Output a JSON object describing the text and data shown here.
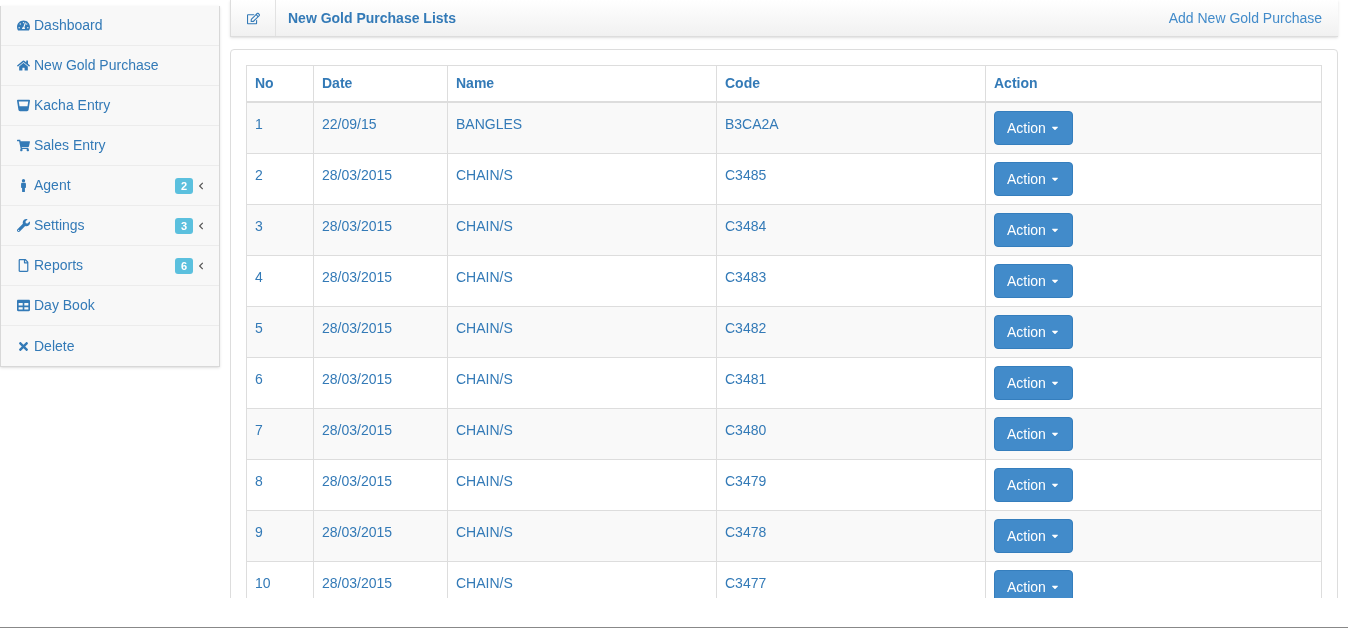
{
  "sidebar": {
    "items": [
      {
        "label": "Dashboard",
        "selected": false
      },
      {
        "label": "New Gold Purchase",
        "selected": false
      },
      {
        "label": "Kacha Entry",
        "selected": false
      },
      {
        "label": "Sales Entry",
        "selected": false
      },
      {
        "label": "Agent",
        "selected": false,
        "badge": "2",
        "submenu": true
      },
      {
        "label": "Settings",
        "selected": false,
        "badge": "3",
        "submenu": true
      },
      {
        "label": "Reports",
        "selected": false,
        "badge": "6",
        "submenu": true
      },
      {
        "label": "Day Book",
        "selected": false
      },
      {
        "label": "Delete",
        "selected": false
      }
    ]
  },
  "header": {
    "title": "New Gold Purchase Lists",
    "link": "Add New Gold Purchase"
  },
  "table": {
    "columns": [
      "No",
      "Date",
      "Name",
      "Code",
      "Action"
    ],
    "rows": [
      {
        "no": "1",
        "date": "22/09/15",
        "name": "BANGLES",
        "code": "B3CA2A",
        "action": "Action"
      },
      {
        "no": "2",
        "date": "28/03/2015",
        "name": "CHAIN/S",
        "code": "C3485",
        "action": "Action"
      },
      {
        "no": "3",
        "date": "28/03/2015",
        "name": "CHAIN/S",
        "code": "C3484",
        "action": "Action"
      },
      {
        "no": "4",
        "date": "28/03/2015",
        "name": "CHAIN/S",
        "code": "C3483",
        "action": "Action"
      },
      {
        "no": "5",
        "date": "28/03/2015",
        "name": "CHAIN/S",
        "code": "C3482",
        "action": "Action"
      },
      {
        "no": "6",
        "date": "28/03/2015",
        "name": "CHAIN/S",
        "code": "C3481",
        "action": "Action"
      },
      {
        "no": "7",
        "date": "28/03/2015",
        "name": "CHAIN/S",
        "code": "C3480",
        "action": "Action"
      },
      {
        "no": "8",
        "date": "28/03/2015",
        "name": "CHAIN/S",
        "code": "C3479",
        "action": "Action"
      },
      {
        "no": "9",
        "date": "28/03/2015",
        "name": "CHAIN/S",
        "code": "C3478",
        "action": "Action"
      },
      {
        "no": "10",
        "date": "28/03/2015",
        "name": "CHAIN/S",
        "code": "C3477",
        "action": "Action"
      }
    ]
  }
}
